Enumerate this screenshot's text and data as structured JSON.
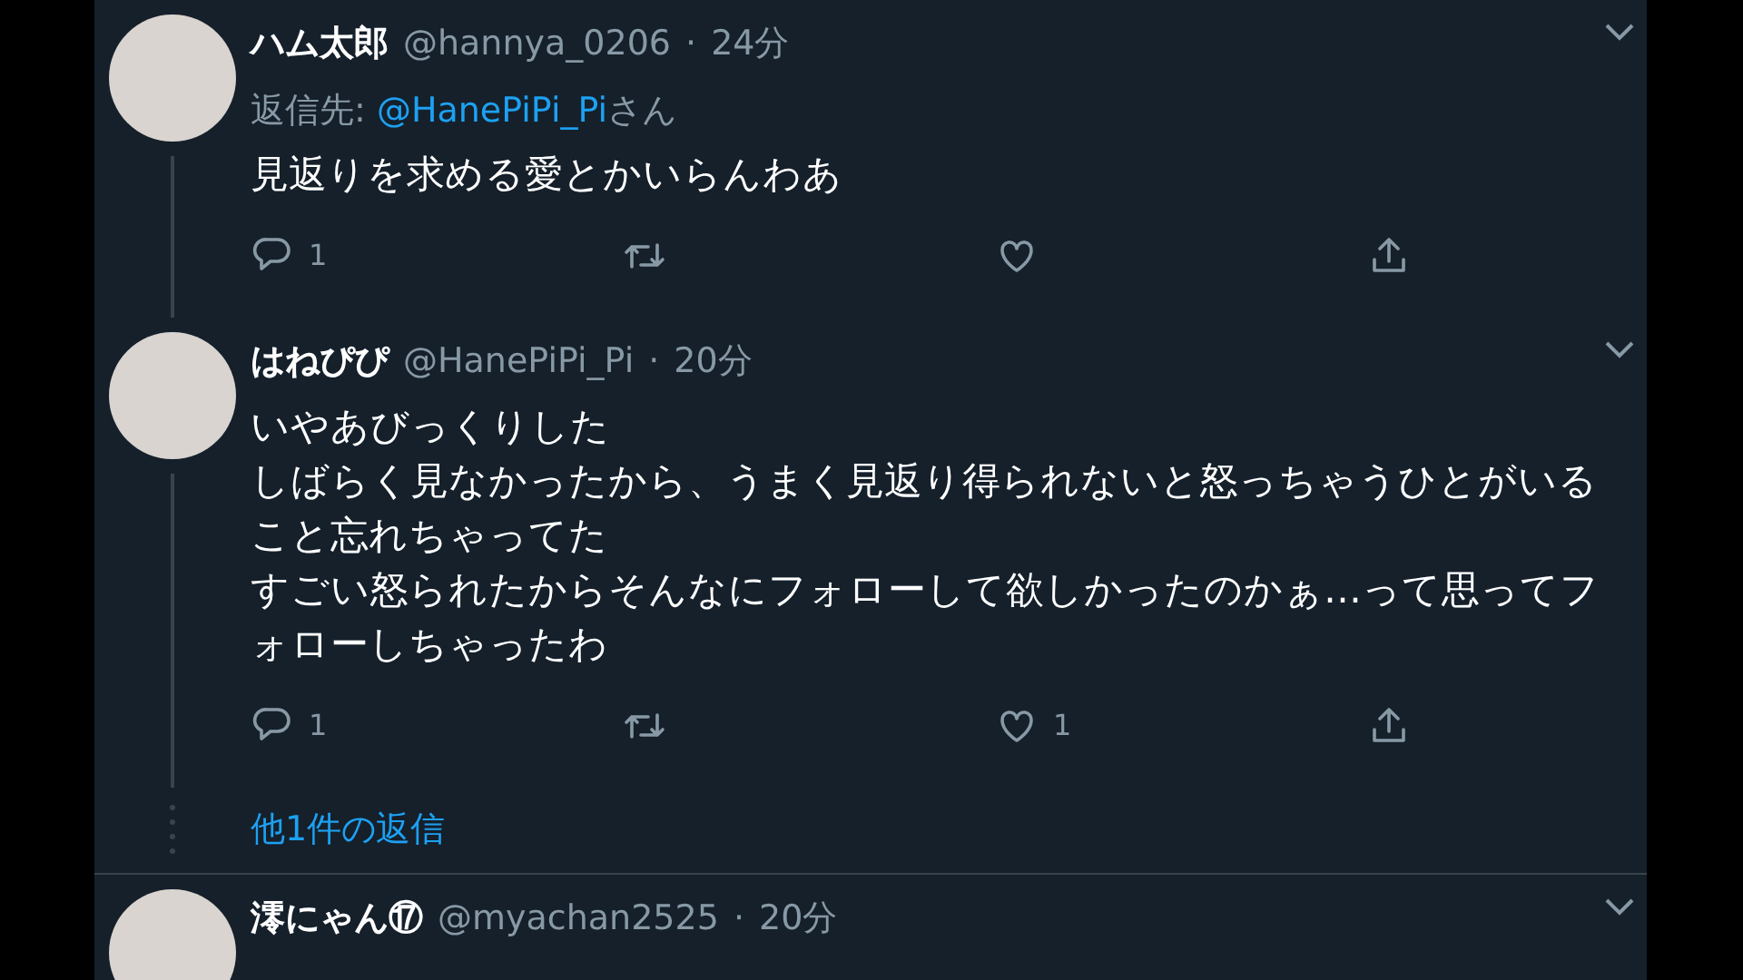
{
  "tweets": [
    {
      "name": "ハム太郎",
      "handle": "@hannya_0206",
      "sep": "·",
      "time": "24分",
      "reply_label": "返信先: ",
      "reply_handle": "@HanePiPi_Pi",
      "reply_suffix": "さん",
      "body": [
        "見返りを求める愛とかいらんわあ"
      ],
      "replies": "1",
      "thread": true
    },
    {
      "name": "はねぴぴ",
      "handle": "@HanePiPi_Pi",
      "sep": "·",
      "time": "20分",
      "body": [
        "いやあびっくりした",
        "しばらく見なかったから、うまく見返り得られないと怒っちゃうひとがいること忘れちゃってた",
        "すごい怒られたからそんなにフォローして欲しかったのかぁ…って思ってフォローしちゃったわ"
      ],
      "replies": "1",
      "likes": "1",
      "thread": true,
      "more_replies": "他1件の返信"
    },
    {
      "name": "澪にゃん⑰",
      "handle": "@myachan2525",
      "sep": "·",
      "time": "20分",
      "thread": false
    }
  ]
}
